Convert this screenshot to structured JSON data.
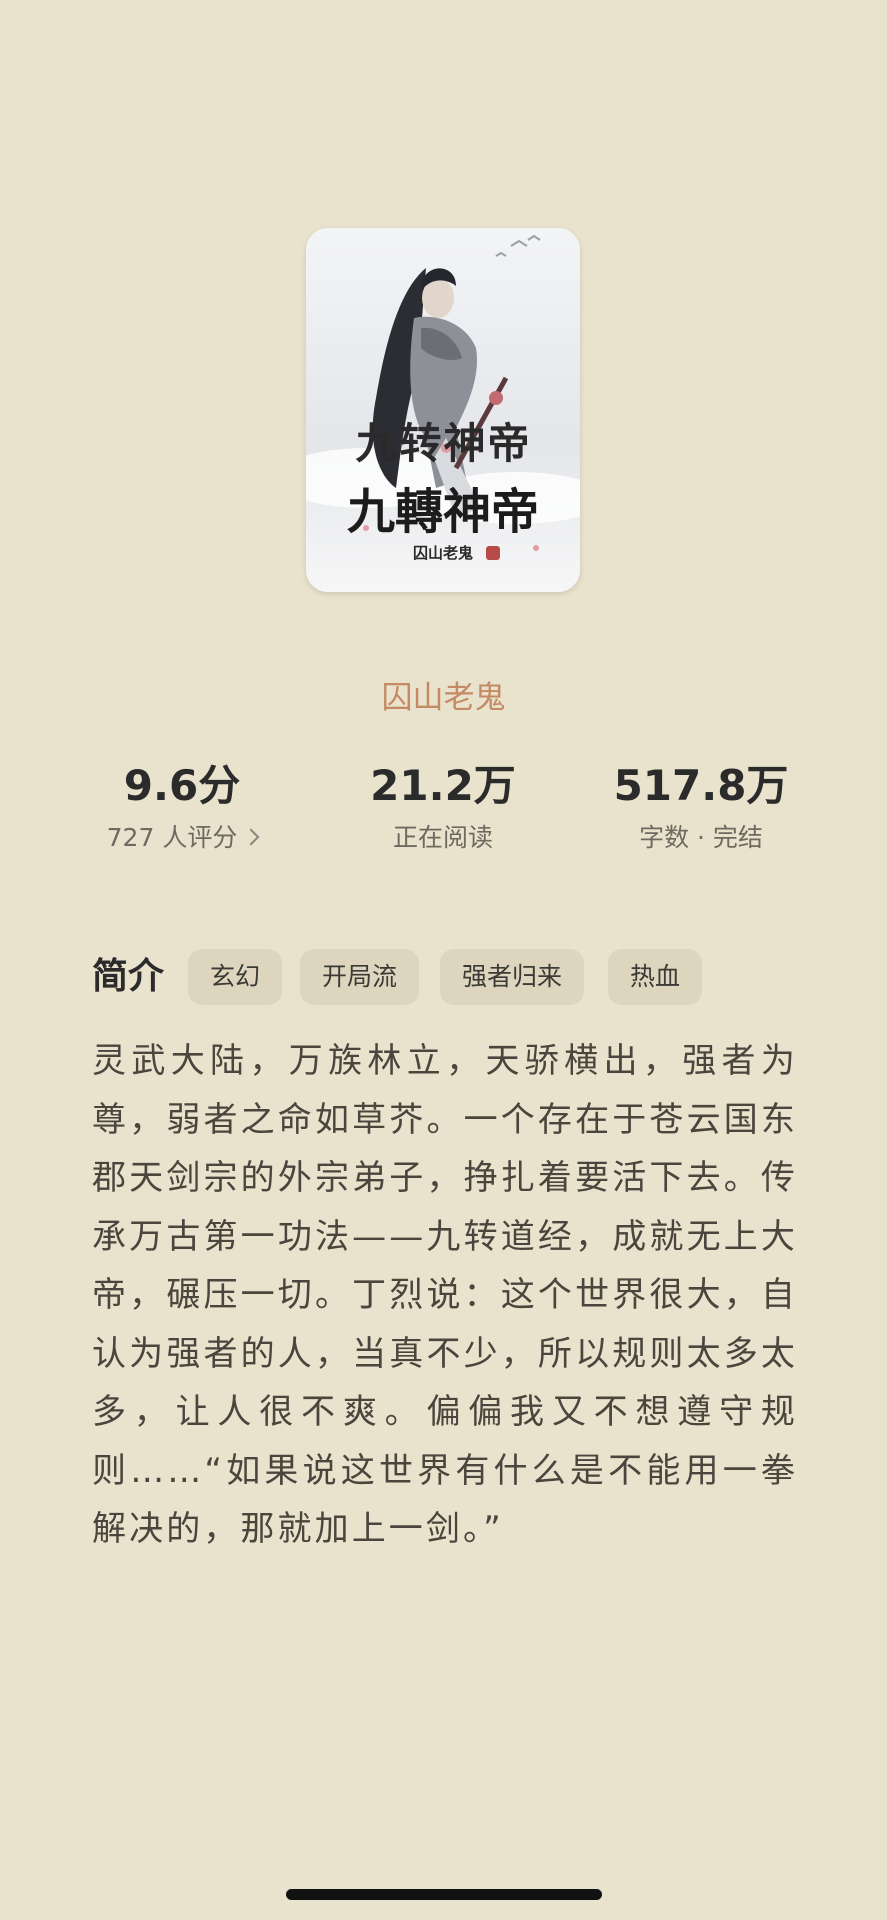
{
  "book": {
    "title": "九转神帝",
    "author": "囚山老鬼",
    "cover": {
      "title_art": "九轉神帝",
      "author_art": "囚山老鬼"
    }
  },
  "stats": {
    "rating": {
      "value": "9.6分",
      "label": "727 人评分"
    },
    "readers": {
      "value": "21.2万",
      "label": "正在阅读"
    },
    "words": {
      "value": "517.8万",
      "label": "字数 · 完结"
    }
  },
  "intro": {
    "heading": "简介",
    "tags": [
      "玄幻",
      "开局流",
      "强者归来",
      "热血"
    ],
    "text": "灵武大陆，万族林立，天骄横出，强者为尊，弱者之命如草芥。一个存在于苍云国东郡天剑宗的外宗弟子，挣扎着要活下去。传承万古第一功法——九转道经，成就无上大帝，碾压一切。丁烈说：这个世界很大，自认为强者的人，当真不少，所以规则太多太多，让人很不爽。偏偏我又不想遵守规则……“如果说这世界有什么是不能用一拳解决的，那就加上一剑。”"
  },
  "colors": {
    "background": "#e9e2cc",
    "author": "#c48a63",
    "tag_bg": "#ddd5bd"
  }
}
